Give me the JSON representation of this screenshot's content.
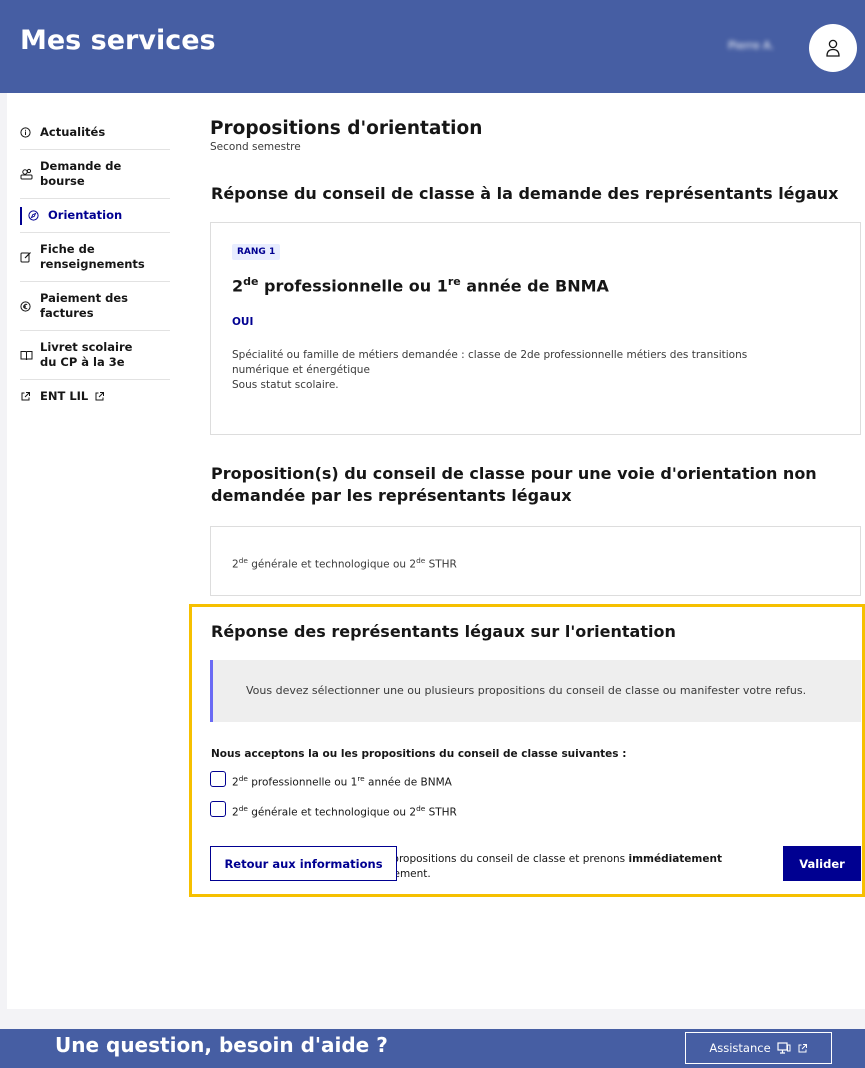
{
  "header": {
    "title": "Mes services",
    "user_name": "Pierre A."
  },
  "sidebar": {
    "items": [
      {
        "label": "Actualités",
        "icon": "info-icon"
      },
      {
        "label": "Demande de bourse",
        "icon": "coins-icon"
      },
      {
        "label": "Orientation",
        "icon": "compass-icon",
        "active": true
      },
      {
        "label": "Fiche de renseignements",
        "icon": "edit-icon"
      },
      {
        "label": "Paiement des factures",
        "icon": "euro-icon"
      },
      {
        "label": "Livret scolaire du CP à la 3e",
        "icon": "book-icon"
      },
      {
        "label": "ENT LIL",
        "icon": "external-link-icon"
      }
    ]
  },
  "main": {
    "title": "Propositions d'orientation",
    "subtitle": "Second semestre",
    "section1_title": "Réponse du conseil de classe à la demande des représentants légaux",
    "proposal": {
      "rank": "RANG 1",
      "title_a": "2",
      "title_a_sup": "de",
      "title_b": " professionnelle ou 1",
      "title_b_sup": "re",
      "title_c": " année de BNMA",
      "answer": "OUI",
      "desc_line1": "Spécialité ou famille de métiers demandée : classe de 2de professionnelle métiers des transitions",
      "desc_line2": "numérique et énergétique",
      "desc_line3": "Sous statut scolaire."
    },
    "section2_title_line1": "Proposition(s) du conseil de classe pour une voie d'orientation non",
    "section2_title_line2": "demandée par les représentants légaux",
    "other_proposal": {
      "a": "2",
      "a_sup": "de",
      "b": " générale et technologique ou 2",
      "b_sup": "de",
      "c": " STHR"
    }
  },
  "response": {
    "title": "Réponse des représentants légaux sur l'orientation",
    "info": "Vous devez sélectionner une ou plusieurs propositions du conseil de classe ou manifester votre refus.",
    "accept_label": "Nous acceptons la ou les propositions du conseil de classe suivantes :",
    "option1": {
      "a": "2",
      "a_sup": "de",
      "b": " professionnelle ou 1",
      "b_sup": "re",
      "c": " année de BNMA"
    },
    "option2": {
      "a": "2",
      "a_sup": "de",
      "b": " générale et technologique ou 2",
      "b_sup": "de",
      "c": " STHR"
    },
    "refuse_part1": "Nous n'acceptons aucune des propositions du conseil de classe et prenons ",
    "refuse_bold": "immédiatement",
    "refuse_part2": "contact avec le chef d'établissement.",
    "back_button": "Retour aux informations",
    "submit_button": "Valider"
  },
  "footer": {
    "question": "Une question, besoin d'aide ?",
    "assist_button": "Assistance"
  },
  "colors": {
    "header": "#465ea3",
    "primary": "#000091",
    "highlight": "#f6c000"
  }
}
